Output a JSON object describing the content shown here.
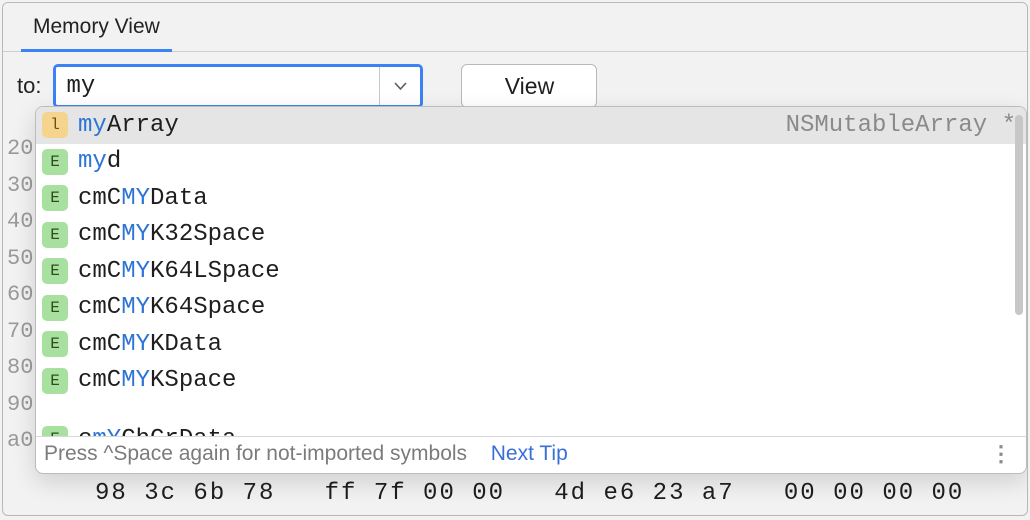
{
  "tab": {
    "label": "Memory View"
  },
  "toolbar": {
    "to_label": "to:",
    "input_value": "my",
    "view_label": "View"
  },
  "gutter": [
    "20",
    "30",
    "40",
    "50",
    "60",
    "70",
    "80",
    "90",
    "a0"
  ],
  "hex_row": "98 3c 6b 78   ff 7f 00 00   4d e6 23 a7   00 00 00 00",
  "suggestions": [
    {
      "icon": "l",
      "kind": "l",
      "pre": "",
      "hl": "my",
      "post": "Array",
      "type": "NSMutableArray *",
      "selected": true
    },
    {
      "icon": "E",
      "kind": "e",
      "pre": "",
      "hl": "my",
      "post": "d",
      "type": "",
      "selected": false
    },
    {
      "icon": "E",
      "kind": "e",
      "pre": "cmC",
      "hl": "MY",
      "post": "Data",
      "type": "",
      "selected": false
    },
    {
      "icon": "E",
      "kind": "e",
      "pre": "cmC",
      "hl": "MY",
      "post": "K32Space",
      "type": "",
      "selected": false
    },
    {
      "icon": "E",
      "kind": "e",
      "pre": "cmC",
      "hl": "MY",
      "post": "K64LSpace",
      "type": "",
      "selected": false
    },
    {
      "icon": "E",
      "kind": "e",
      "pre": "cmC",
      "hl": "MY",
      "post": "K64Space",
      "type": "",
      "selected": false
    },
    {
      "icon": "E",
      "kind": "e",
      "pre": "cmC",
      "hl": "MY",
      "post": "KData",
      "type": "",
      "selected": false
    },
    {
      "icon": "E",
      "kind": "e",
      "pre": "cmC",
      "hl": "MY",
      "post": "KSpace",
      "type": "",
      "selected": false
    }
  ],
  "partial_suggestion": {
    "icon": "E",
    "kind": "e",
    "pre": "c",
    "hl": "mY",
    "post": "ChCrData",
    "type": ""
  },
  "footer": {
    "hint_text": "Press ^Space again for not-imported symbols",
    "next_tip": "Next Tip"
  }
}
